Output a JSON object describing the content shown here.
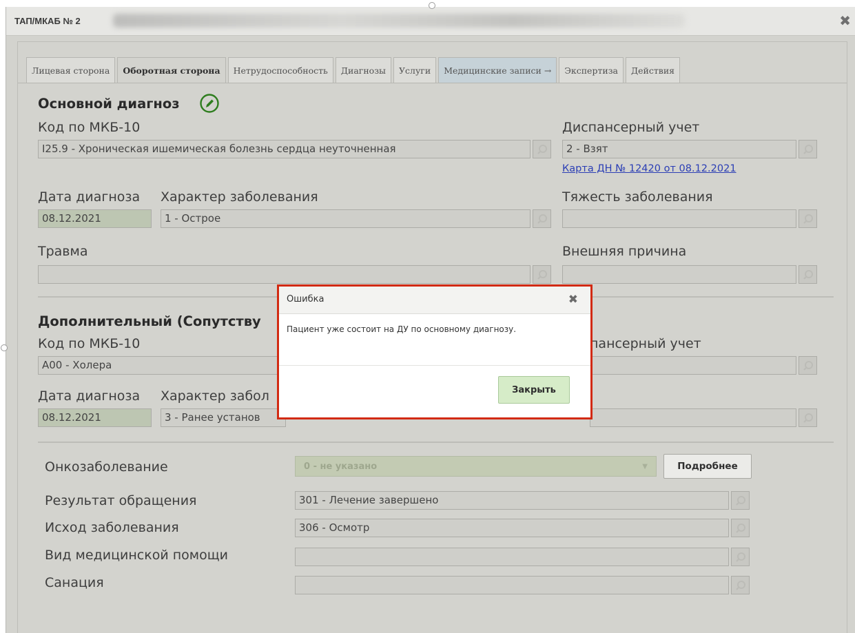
{
  "window": {
    "title": "ТАП/МКАБ № 2",
    "close_icon": "close-icon"
  },
  "tabs": [
    {
      "label": "Лицевая сторона"
    },
    {
      "label": "Оборотная сторона",
      "active": true
    },
    {
      "label": "Нетрудоспособность"
    },
    {
      "label": "Диагнозы"
    },
    {
      "label": "Услуги"
    },
    {
      "label": "Медицинские записи →"
    },
    {
      "label": "Экспертиза"
    },
    {
      "label": "Действия"
    }
  ],
  "main_diag": {
    "heading": "Основной диагноз",
    "mkb_label": "Код по МКБ-10",
    "mkb_value": "I25.9 - Хроническая ишемическая болезнь сердца неуточненная",
    "disp_label": "Диспансерный учет",
    "disp_value": "2 - Взят",
    "disp_link": "Карта ДН № 12420 от 08.12.2021",
    "date_label": "Дата диагноза",
    "date_value": "08.12.2021",
    "char_label": "Характер заболевания",
    "char_value": "1 - Острое",
    "severity_label": "Тяжесть заболевания",
    "severity_value": "",
    "trauma_label": "Травма",
    "trauma_value": "",
    "ext_label": "Внешняя причина",
    "ext_value": ""
  },
  "add_diag": {
    "heading": "Дополнительный (Сопутству",
    "mkb_label": "Код по МКБ-10",
    "mkb_value": "А00 - Холера",
    "disp_label": "пансерный учет",
    "date_label": "Дата диагноза",
    "date_value": "08.12.2021",
    "char_label": "Характер забол",
    "char_value": "3 - Ранее установ"
  },
  "bottom": {
    "onco_label": "Онкозаболевание",
    "onco_value": "0 - не указано",
    "more_button": "Подробнее",
    "result_label": "Результат обращения",
    "result_value": "301 - Лечение завершено",
    "outcome_label": "Исход заболевания",
    "outcome_value": "306 - Осмотр",
    "care_label": "Вид медицинской помощи",
    "care_value": "",
    "sanation_label": "Санация",
    "sanation_value": ""
  },
  "dialog": {
    "title": "Ошибка",
    "message": "Пациент уже состоит на ДУ по основному диагнозу.",
    "close_button": "Закрыть"
  },
  "colors": {
    "dialog_border": "#d22a12",
    "primary_button": "#d6ecc8",
    "link": "#2b3eb5",
    "pencil_icon": "#2e7d1e"
  }
}
